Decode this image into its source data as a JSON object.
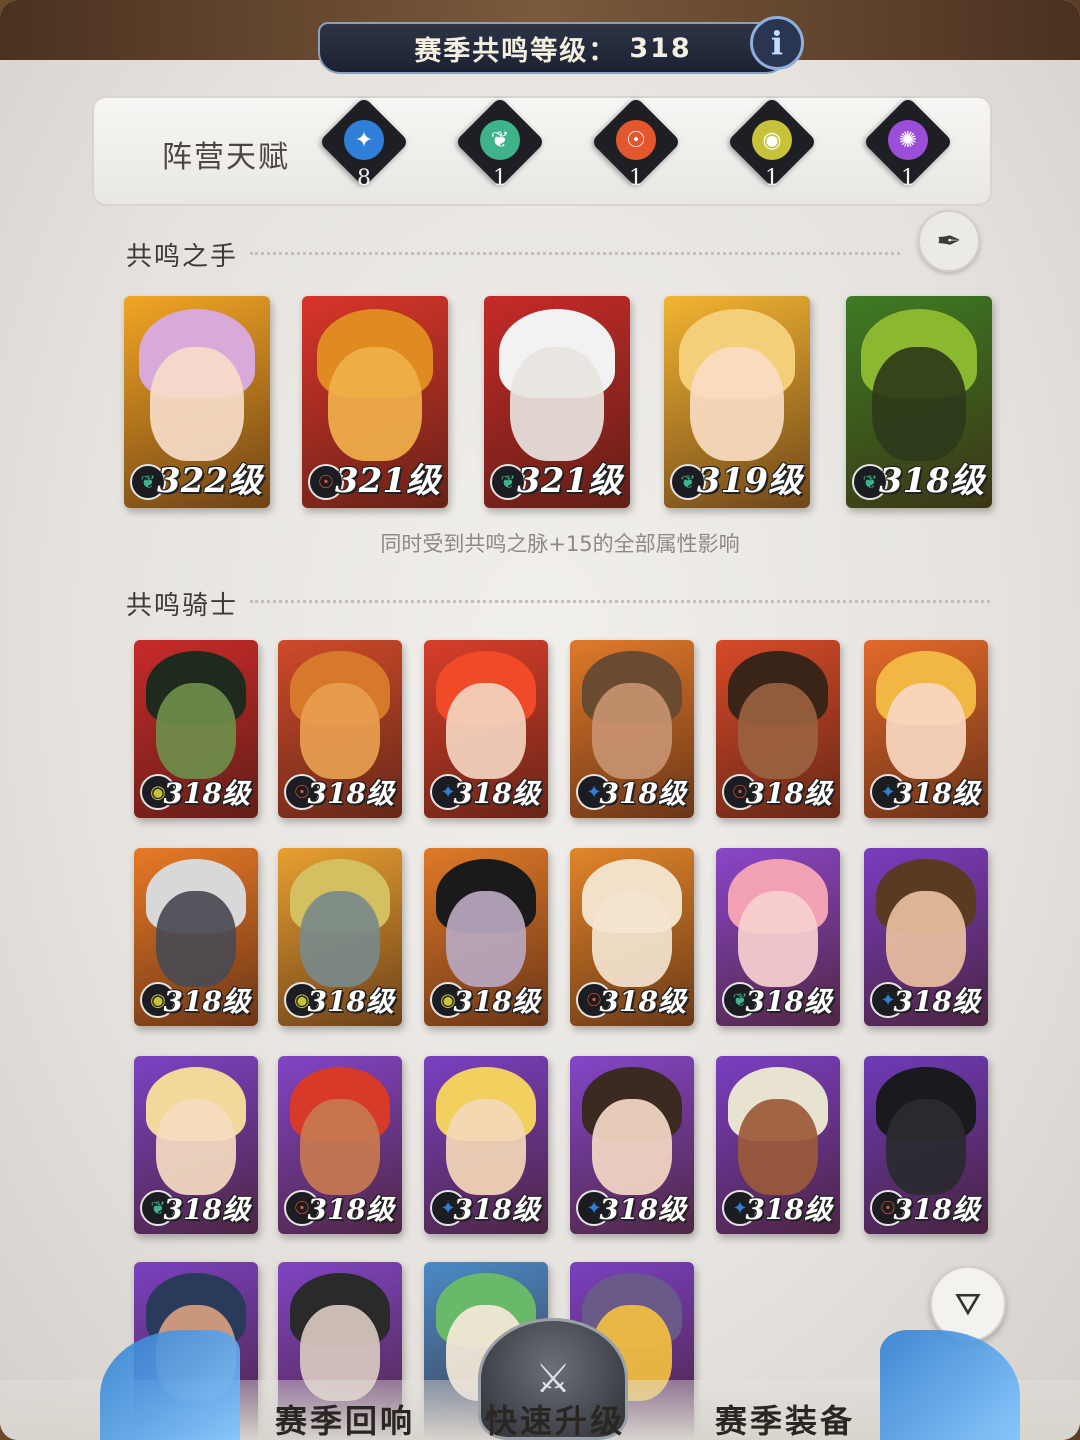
{
  "header": {
    "title": "赛季共鸣等级：",
    "level": "318",
    "info_icon": "i"
  },
  "talents": {
    "label": "阵营天赋",
    "factions": [
      {
        "icon": "compass-star-icon",
        "color": "#2f7fd8",
        "glyph": "✦",
        "count": "8"
      },
      {
        "icon": "lotus-leaf-icon",
        "color": "#3fb38a",
        "glyph": "❦",
        "count": "1"
      },
      {
        "icon": "horde-crest-icon",
        "color": "#e4572e",
        "glyph": "☉",
        "count": "1"
      },
      {
        "icon": "eye-gear-icon",
        "color": "#c8c23a",
        "glyph": "◉",
        "count": "1"
      },
      {
        "icon": "sunburst-icon",
        "color": "#9b4fd8",
        "glyph": "✺",
        "count": "1"
      }
    ]
  },
  "hands_section": {
    "title": "共鸣之手",
    "note": "同时受到共鸣之脉+15的全部属性影响",
    "cards": [
      {
        "level": "322级",
        "bg": "#f2a624",
        "hair": "#d9a9d9",
        "face": "#f6dcc8",
        "faction": "lotus-leaf-icon",
        "fcolor": "#3fb38a",
        "glyph": "❦"
      },
      {
        "level": "321级",
        "bg": "#d9352a",
        "hair": "#e08a22",
        "face": "#f0b04a",
        "faction": "horde-crest-icon",
        "fcolor": "#e4572e",
        "glyph": "☉"
      },
      {
        "level": "321级",
        "bg": "#c62a28",
        "hair": "#f2f2f2",
        "face": "#e8e4e0",
        "faction": "lotus-leaf-icon",
        "fcolor": "#3fb38a",
        "glyph": "❦"
      },
      {
        "level": "319级",
        "bg": "#f3b531",
        "hair": "#f4cf7a",
        "face": "#f8dcc2",
        "faction": "lotus-leaf-icon",
        "fcolor": "#3fb38a",
        "glyph": "❦"
      },
      {
        "level": "318级",
        "bg": "#3d7b23",
        "hair": "#8ab830",
        "face": "#2e3a1a",
        "faction": "lotus-leaf-icon",
        "fcolor": "#3fb38a",
        "glyph": "❦"
      }
    ]
  },
  "knights_section": {
    "title": "共鸣骑士",
    "cards": [
      {
        "level": "318级",
        "bg": "#c82a2a",
        "hair": "#1d2a1d",
        "face": "#6e8e4a",
        "faction": "eye-gear-icon",
        "fcolor": "#c8c23a",
        "glyph": "◉"
      },
      {
        "level": "318级",
        "bg": "#cf4a2a",
        "hair": "#d6792a",
        "face": "#e8a050",
        "faction": "horde-crest-icon",
        "fcolor": "#e4572e",
        "glyph": "☉"
      },
      {
        "level": "318级",
        "bg": "#d83e2a",
        "hair": "#f04a28",
        "face": "#f4d4c0",
        "faction": "compass-star-icon",
        "fcolor": "#2f7fd8",
        "glyph": "✦"
      },
      {
        "level": "318级",
        "bg": "#e07a2a",
        "hair": "#6a4a30",
        "face": "#c89270",
        "faction": "compass-star-icon",
        "fcolor": "#2f7fd8",
        "glyph": "✦"
      },
      {
        "level": "318级",
        "bg": "#d64a28",
        "hair": "#3a2418",
        "face": "#9a6240",
        "faction": "horde-crest-icon",
        "fcolor": "#e4572e",
        "glyph": "☉"
      },
      {
        "level": "318级",
        "bg": "#e36a2a",
        "hair": "#f2b642",
        "face": "#f8d8c0",
        "faction": "compass-star-icon",
        "fcolor": "#2f7fd8",
        "glyph": "✦"
      },
      {
        "level": "318级",
        "bg": "#e87a26",
        "hair": "#d8d8d8",
        "face": "#4a4a52",
        "faction": "eye-gear-icon",
        "fcolor": "#c8c23a",
        "glyph": "◉"
      },
      {
        "level": "318级",
        "bg": "#e8a030",
        "hair": "#d4c060",
        "face": "#7a8a8a",
        "faction": "eye-gear-icon",
        "fcolor": "#c8c23a",
        "glyph": "◉"
      },
      {
        "level": "318级",
        "bg": "#e07a28",
        "hair": "#1a1a1a",
        "face": "#b8a8c0",
        "faction": "eye-gear-icon",
        "fcolor": "#c8c23a",
        "glyph": "◉"
      },
      {
        "level": "318级",
        "bg": "#e2862a",
        "hair": "#f2e0c8",
        "face": "#f4e4d0",
        "faction": "horde-crest-icon",
        "fcolor": "#e4572e",
        "glyph": "☉"
      },
      {
        "level": "318级",
        "bg": "#8a46c8",
        "hair": "#f2a0b4",
        "face": "#f8d0d0",
        "faction": "lotus-leaf-icon",
        "fcolor": "#3fb38a",
        "glyph": "❦"
      },
      {
        "level": "318级",
        "bg": "#7a3cc0",
        "hair": "#5a3a22",
        "face": "#e8c0a0",
        "faction": "compass-star-icon",
        "fcolor": "#2f7fd8",
        "glyph": "✦"
      },
      {
        "level": "318级",
        "bg": "#7c42c4",
        "hair": "#f2d89a",
        "face": "#f4dcc0",
        "faction": "lotus-leaf-icon",
        "fcolor": "#3fb38a",
        "glyph": "❦"
      },
      {
        "level": "318级",
        "bg": "#8244c6",
        "hair": "#d83a2a",
        "face": "#c87a50",
        "faction": "horde-crest-icon",
        "fcolor": "#e4572e",
        "glyph": "☉"
      },
      {
        "level": "318级",
        "bg": "#7a40c2",
        "hair": "#f2d060",
        "face": "#f4d8b8",
        "faction": "compass-star-icon",
        "fcolor": "#2f7fd8",
        "glyph": "✦"
      },
      {
        "level": "318级",
        "bg": "#8446c8",
        "hair": "#3a2a22",
        "face": "#f4d8c4",
        "faction": "compass-star-icon",
        "fcolor": "#2f7fd8",
        "glyph": "✦"
      },
      {
        "level": "318级",
        "bg": "#7a3ec2",
        "hair": "#e8e2d0",
        "face": "#9a5a3a",
        "faction": "compass-star-icon",
        "fcolor": "#2f7fd8",
        "glyph": "✦"
      },
      {
        "level": "318级",
        "bg": "#6e3ab8",
        "hair": "#1a1a1e",
        "face": "#2a2a30",
        "faction": "horde-crest-icon",
        "fcolor": "#e4572e",
        "glyph": "☉"
      },
      {
        "level": "",
        "bg": "#7a40c0",
        "hair": "#2a3a5a",
        "face": "#d8a080",
        "faction": "",
        "fcolor": "",
        "glyph": ""
      },
      {
        "level": "",
        "bg": "#8044c4",
        "hair": "#2a2a2a",
        "face": "#d8c8c0",
        "faction": "",
        "fcolor": "",
        "glyph": ""
      },
      {
        "level": "",
        "bg": "#4a8ac8",
        "hair": "#6ab86a",
        "face": "#f4e8d8",
        "faction": "",
        "fcolor": "",
        "glyph": ""
      },
      {
        "level": "",
        "bg": "#7a40c0",
        "hair": "#6a5a8a",
        "face": "#f2c040",
        "faction": "",
        "fcolor": "",
        "glyph": ""
      }
    ]
  },
  "bottom_tabs": {
    "left": "赛季回响",
    "center": "快速升级",
    "right": "赛季装备"
  },
  "filter_icon": "filter-list-icon",
  "quill_icon": "quill-icon"
}
